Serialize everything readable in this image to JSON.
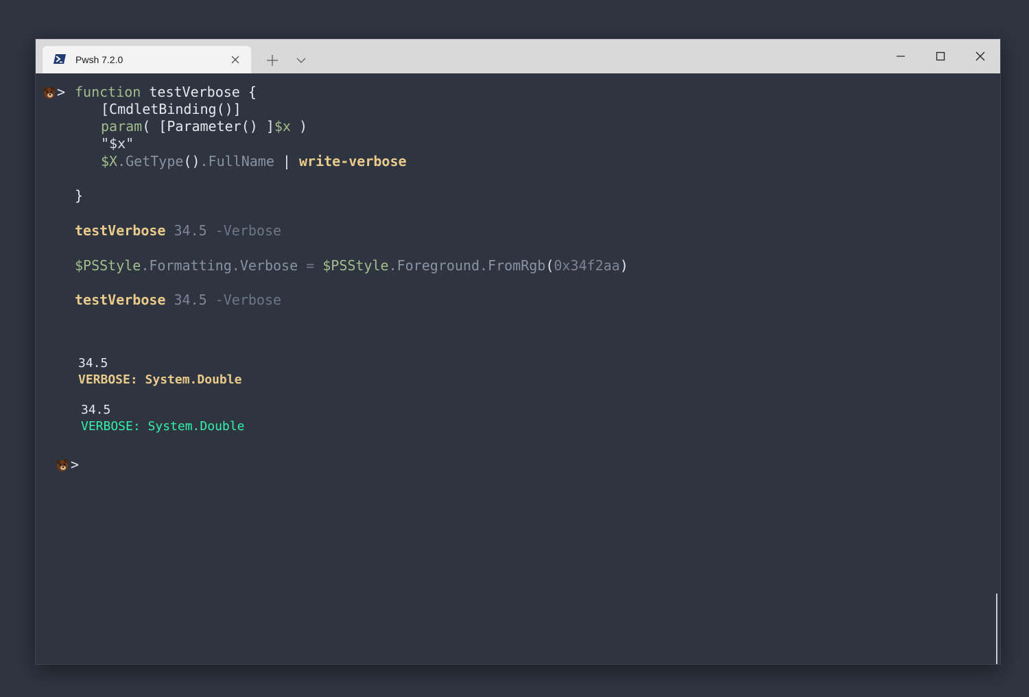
{
  "window": {
    "tab_title": "Pwsh 7.2.0",
    "tab_icon": "powershell-icon",
    "buttons": [
      "minimize-icon",
      "maximize-icon",
      "close-icon"
    ]
  },
  "terminal": {
    "prompt_symbol": ">",
    "lines": {
      "l1_kw": "function",
      "l1_name": " testVerbose {",
      "l2": "[CmdletBinding()]",
      "l3_kw": "param",
      "l3_a": "( [Parameter() ]",
      "l3_var": "$x",
      "l3_b": " )",
      "l4": "\"$x\"",
      "l5_var": "$X",
      "l5_prop": ".GetType",
      "l5_paren": "()",
      "l5_prop2": ".FullName",
      "l5_pipe": " | ",
      "l5_cmd": "write-verbose",
      "l6": "}",
      "l7_cmd": "testVerbose",
      "l7_num": " 34.5",
      "l7_param": " -Verbose",
      "l8_var": "$PSStyle",
      "l8_prop": ".Formatting.Verbose",
      "l8_eq": " = ",
      "l8_var2": "$PSStyle",
      "l8_prop2": ".Foreground.FromRgb",
      "l8_paren_open": "(",
      "l8_hex": "0x34f2aa",
      "l8_paren_close": ")",
      "l9_cmd": "testVerbose",
      "l9_num": " 34.5",
      "l9_param": " -Verbose"
    },
    "output": {
      "o1_value": "34.5",
      "o1_verbose": "VERBOSE: System.Double",
      "o2_value": "34.5",
      "o2_verbose": "VERBOSE: System.Double"
    },
    "colors": {
      "background": "#2e3440",
      "verbose_default": "#ebcb8b",
      "verbose_custom": "#34f2aa"
    }
  }
}
